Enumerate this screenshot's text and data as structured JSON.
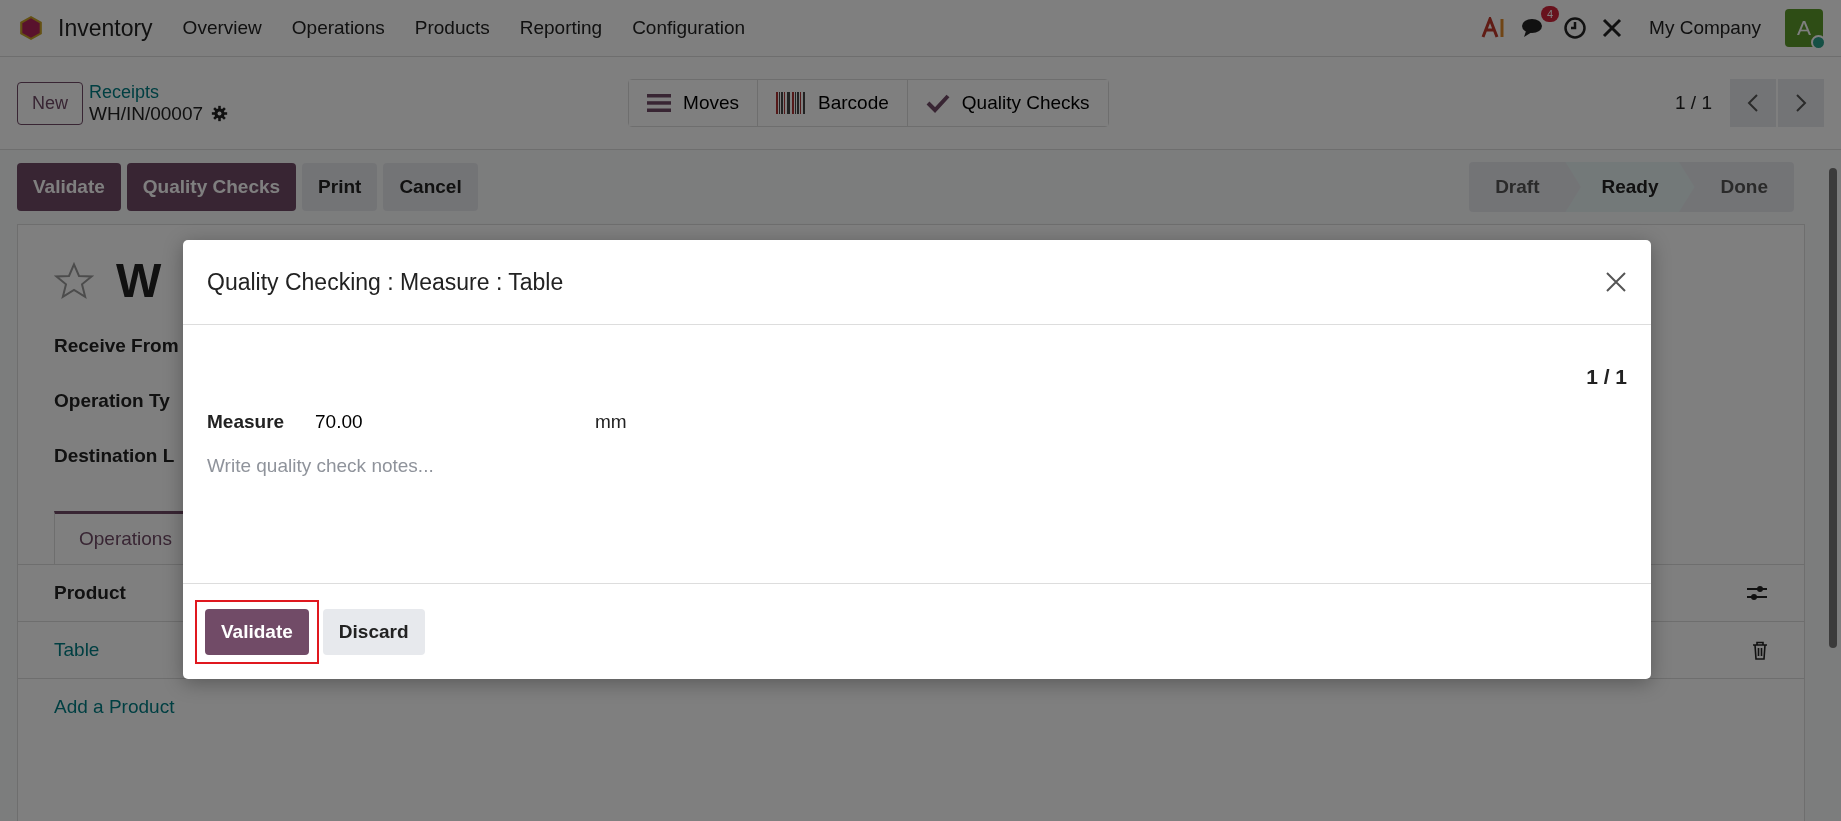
{
  "navbar": {
    "app_name": "Inventory",
    "menu": [
      "Overview",
      "Operations",
      "Products",
      "Reporting",
      "Configuration"
    ],
    "messages_badge": "4",
    "company": "My Company",
    "avatar_initial": "A"
  },
  "control_panel": {
    "new_button": "New",
    "breadcrumb": "Receipts",
    "record": "WH/IN/00007",
    "smart_buttons": [
      {
        "label": "Moves",
        "kind": "list"
      },
      {
        "label": "Barcode",
        "kind": "barcode"
      },
      {
        "label": "Quality Checks",
        "kind": "check"
      }
    ],
    "pager": "1 / 1"
  },
  "actions": [
    {
      "label": "Validate",
      "kind": "primary"
    },
    {
      "label": "Quality Checks",
      "kind": "primary"
    },
    {
      "label": "Print",
      "kind": "secondary"
    },
    {
      "label": "Cancel",
      "kind": "secondary"
    }
  ],
  "status_steps": [
    {
      "label": "Draft",
      "selected": false
    },
    {
      "label": "Ready",
      "selected": true
    },
    {
      "label": "Done",
      "selected": false
    }
  ],
  "form": {
    "title": "W",
    "starred": false,
    "fields": [
      "Receive From",
      "Operation Ty",
      "Destination L"
    ],
    "tabs": [
      {
        "label": "Operations",
        "selected": true
      }
    ],
    "table": {
      "columns": [
        "Product"
      ],
      "rows": [
        {
          "product": "Table"
        }
      ],
      "add_line": "Add a Product"
    }
  },
  "dialog": {
    "title": "Quality Checking : Measure : Table",
    "counter": "1 / 1",
    "measure_label": "Measure",
    "measure_value": "70.00",
    "unit": "mm",
    "notes_placeholder": "Write quality check notes...",
    "buttons": [
      {
        "label": "Validate",
        "kind": "primary",
        "highlighted": true
      },
      {
        "label": "Discard",
        "kind": "secondary",
        "highlighted": false
      }
    ]
  }
}
